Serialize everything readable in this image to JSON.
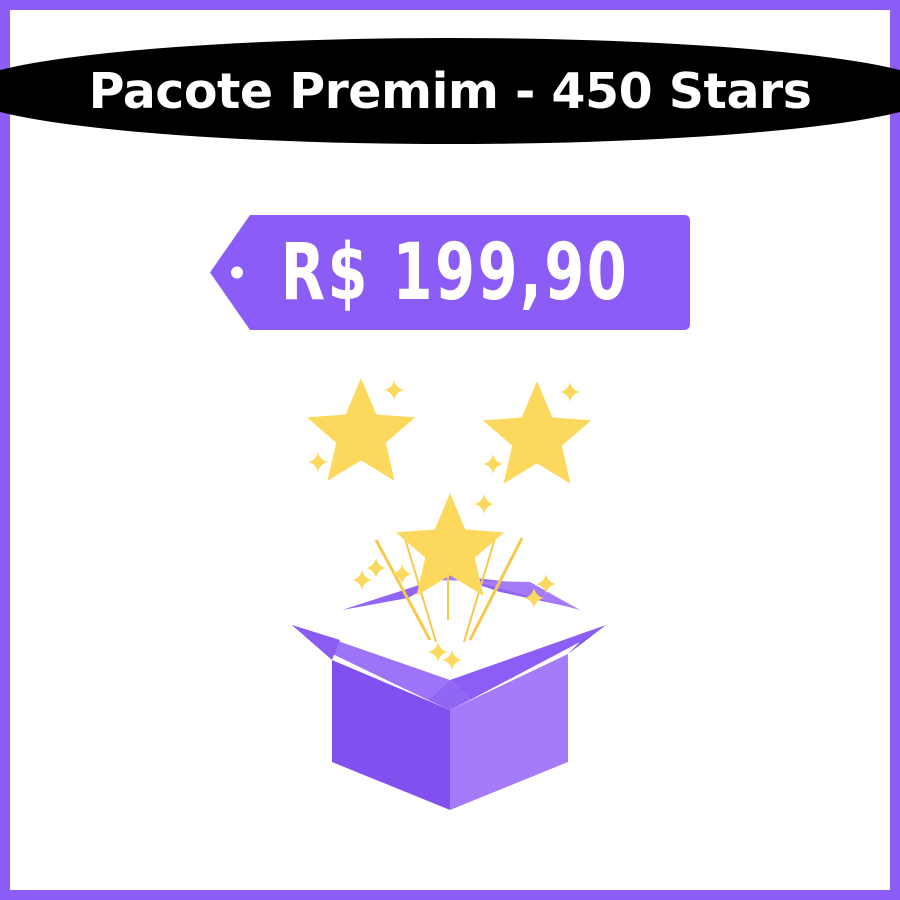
{
  "title": "Pacote Premim - 450 Stars",
  "price": "R$ 199,90",
  "colors": {
    "border": "#8b5cf6",
    "title_band": "#000000",
    "price_tag": "#8b5cf6",
    "star": "#fcd95c",
    "box_light": "#a57bfa",
    "box_dark": "#8350f0"
  },
  "illustration": {
    "icon": "gift-box-with-stars-icon",
    "star_count": 3
  }
}
